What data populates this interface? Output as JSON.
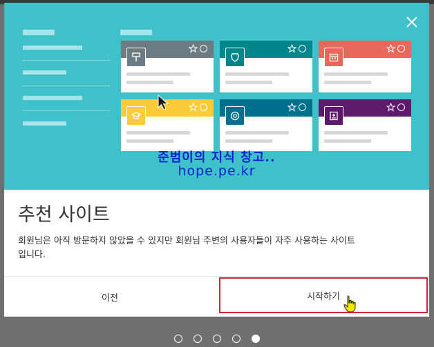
{
  "dialog": {
    "title": "추천 사이트",
    "description_line1": "회원님은 아직 방문하지 않았을 수 있지만 회원님 주변의 사용자들이 자주 사용하는 사이트",
    "description_line2": "입니다.",
    "prev_label": "이전",
    "start_label": "시작하기"
  },
  "watermark": {
    "line1": "준범이의 지식 창고..",
    "line2": "hope.pe.kr"
  },
  "colors": {
    "hero_bg": "#3fc1c9",
    "highlight_border": "#d9242b",
    "card_bars": [
      "#6d7b82",
      "#00868b",
      "#e8695b",
      "#fccb3a",
      "#00708f",
      "#5d1a6d"
    ]
  },
  "cards": [
    {
      "icon": "paint-roller-icon"
    },
    {
      "icon": "shield-badge-icon"
    },
    {
      "icon": "calendar-icon"
    },
    {
      "icon": "graduation-cap-icon"
    },
    {
      "icon": "camera-aperture-icon"
    },
    {
      "icon": "document-image-icon"
    }
  ],
  "pager": {
    "total": 5,
    "active_index": 4
  }
}
